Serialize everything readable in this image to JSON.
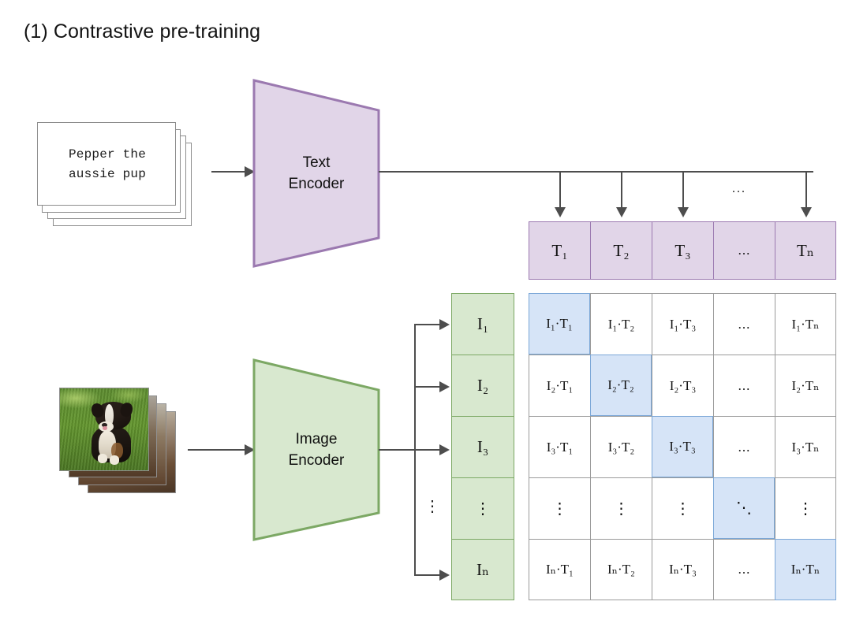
{
  "title": "(1) Contrastive pre-training",
  "text_input": {
    "name": "text-caption-card-stack",
    "line1": "Pepper the",
    "line2": "aussie pup",
    "card_count": 4
  },
  "image_input": {
    "name": "image-photo-card-stack",
    "alt": "australian shepherd puppy sitting on grass",
    "card_count": 4
  },
  "encoders": {
    "text": {
      "line1": "Text",
      "line2": "Encoder",
      "fill": "#e1d5e8",
      "stroke": "#9b79b0"
    },
    "image": {
      "line1": "Image",
      "line2": "Encoder",
      "fill": "#d8e8cf",
      "stroke": "#7ca864"
    }
  },
  "text_embeddings": {
    "label": "T",
    "cells": [
      {
        "base": "T",
        "sub": "1",
        "text": "T₁"
      },
      {
        "base": "T",
        "sub": "2",
        "text": "T₂"
      },
      {
        "base": "T",
        "sub": "3",
        "text": "T₃"
      },
      {
        "base": "",
        "sub": "",
        "text": "..."
      },
      {
        "base": "T",
        "sub": "N",
        "text": "Tₙ"
      }
    ]
  },
  "image_embeddings": {
    "label": "I",
    "cells": [
      {
        "base": "I",
        "sub": "1",
        "text": "I₁"
      },
      {
        "base": "I",
        "sub": "2",
        "text": "I₂"
      },
      {
        "base": "I",
        "sub": "3",
        "text": "I₃"
      },
      {
        "base": "",
        "sub": "",
        "text": "⋮"
      },
      {
        "base": "I",
        "sub": "N",
        "text": "Iₙ"
      }
    ]
  },
  "bus_ellipsis": "...",
  "image_bus_ellipsis": "⋮",
  "chart_data": {
    "type": "heatmap",
    "title": "(1) Contrastive pre-training",
    "description": "CLIP contrastive similarity matrix of image embeddings (rows) against text embeddings (columns); diagonal entries are the positive pairs and are highlighted.",
    "row_labels": [
      "I₁",
      "I₂",
      "I₃",
      "⋮",
      "Iₙ"
    ],
    "col_labels": [
      "T₁",
      "T₂",
      "T₃",
      "...",
      "Tₙ"
    ],
    "highlight_color": "#d6e4f7",
    "highlight_border": "#7ba7d7",
    "cell_color": "#ffffff",
    "grid": true,
    "legend": "none",
    "rows": [
      {
        "label": "I₁",
        "cells": [
          {
            "text": "I₁·T₁",
            "i": "I",
            "isub": "1",
            "t": "T",
            "tsub": "1",
            "highlight": true
          },
          {
            "text": "I₁·T₂",
            "i": "I",
            "isub": "1",
            "t": "T",
            "tsub": "2",
            "highlight": false
          },
          {
            "text": "I₁·T₃",
            "i": "I",
            "isub": "1",
            "t": "T",
            "tsub": "3",
            "highlight": false
          },
          {
            "text": "...",
            "i": "",
            "isub": "",
            "t": "",
            "tsub": "",
            "highlight": false
          },
          {
            "text": "I₁·Tₙ",
            "i": "I",
            "isub": "1",
            "t": "T",
            "tsub": "N",
            "highlight": false
          }
        ]
      },
      {
        "label": "I₂",
        "cells": [
          {
            "text": "I₂·T₁",
            "i": "I",
            "isub": "2",
            "t": "T",
            "tsub": "1",
            "highlight": false
          },
          {
            "text": "I₂·T₂",
            "i": "I",
            "isub": "2",
            "t": "T",
            "tsub": "2",
            "highlight": true
          },
          {
            "text": "I₂·T₃",
            "i": "I",
            "isub": "2",
            "t": "T",
            "tsub": "3",
            "highlight": false
          },
          {
            "text": "...",
            "i": "",
            "isub": "",
            "t": "",
            "tsub": "",
            "highlight": false
          },
          {
            "text": "I₂·Tₙ",
            "i": "I",
            "isub": "2",
            "t": "T",
            "tsub": "N",
            "highlight": false
          }
        ]
      },
      {
        "label": "I₃",
        "cells": [
          {
            "text": "I₃·T₁",
            "i": "I",
            "isub": "3",
            "t": "T",
            "tsub": "1",
            "highlight": false
          },
          {
            "text": "I₃·T₂",
            "i": "I",
            "isub": "3",
            "t": "T",
            "tsub": "2",
            "highlight": false
          },
          {
            "text": "I₃·T₃",
            "i": "I",
            "isub": "3",
            "t": "T",
            "tsub": "3",
            "highlight": true
          },
          {
            "text": "...",
            "i": "",
            "isub": "",
            "t": "",
            "tsub": "",
            "highlight": false
          },
          {
            "text": "I₃·Tₙ",
            "i": "I",
            "isub": "3",
            "t": "T",
            "tsub": "N",
            "highlight": false
          }
        ]
      },
      {
        "label": "⋮",
        "cells": [
          {
            "text": "⋮",
            "i": "",
            "isub": "",
            "t": "",
            "tsub": "",
            "highlight": false
          },
          {
            "text": "⋮",
            "i": "",
            "isub": "",
            "t": "",
            "tsub": "",
            "highlight": false
          },
          {
            "text": "⋮",
            "i": "",
            "isub": "",
            "t": "",
            "tsub": "",
            "highlight": false
          },
          {
            "text": "⋱",
            "i": "",
            "isub": "",
            "t": "",
            "tsub": "",
            "highlight": true
          },
          {
            "text": "⋮",
            "i": "",
            "isub": "",
            "t": "",
            "tsub": "",
            "highlight": false
          }
        ]
      },
      {
        "label": "Iₙ",
        "cells": [
          {
            "text": "Iₙ·T₁",
            "i": "I",
            "isub": "N",
            "t": "T",
            "tsub": "1",
            "highlight": false
          },
          {
            "text": "Iₙ·T₂",
            "i": "I",
            "isub": "N",
            "t": "T",
            "tsub": "2",
            "highlight": false
          },
          {
            "text": "Iₙ·T₃",
            "i": "I",
            "isub": "N",
            "t": "T",
            "tsub": "3",
            "highlight": false
          },
          {
            "text": "...",
            "i": "",
            "isub": "",
            "t": "",
            "tsub": "",
            "highlight": false
          },
          {
            "text": "Iₙ·Tₙ",
            "i": "I",
            "isub": "N",
            "t": "T",
            "tsub": "N",
            "highlight": true
          }
        ]
      }
    ]
  }
}
